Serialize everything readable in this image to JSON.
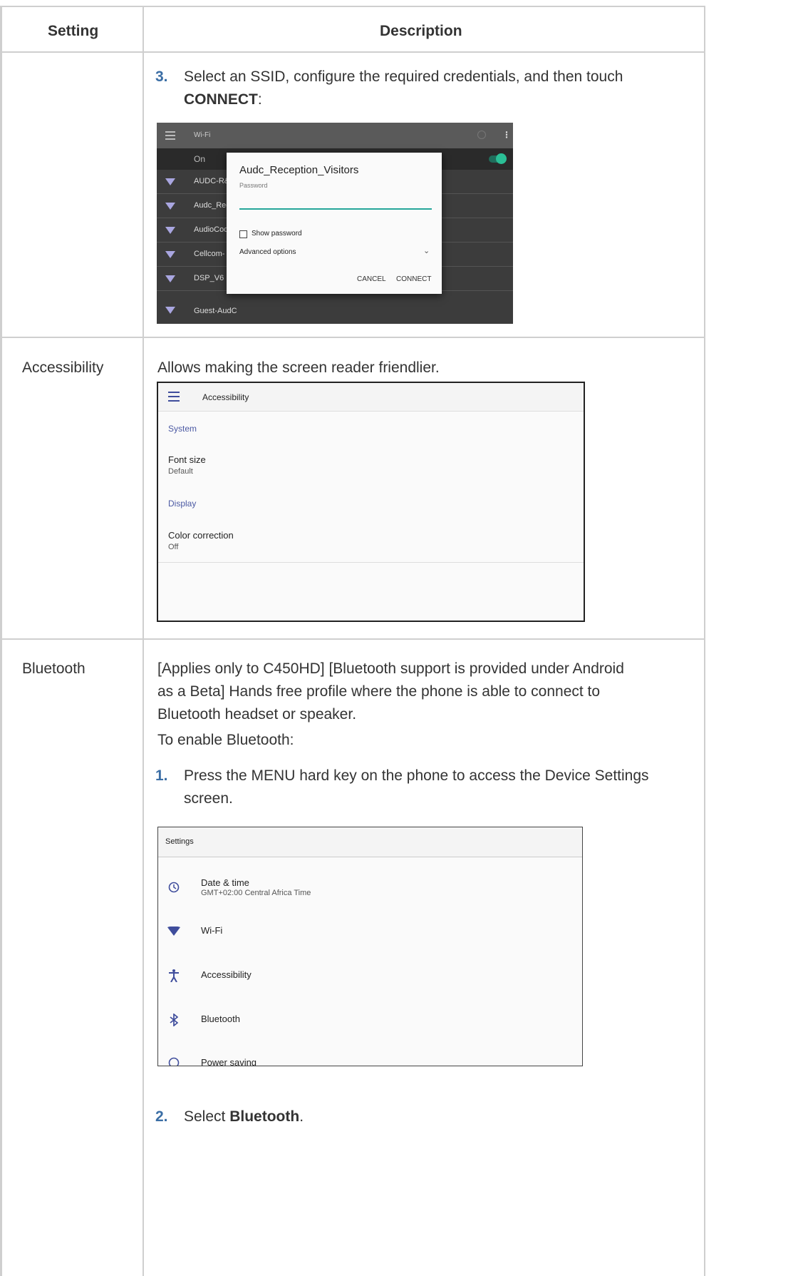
{
  "table": {
    "header_setting": "Setting",
    "header_description": "Description"
  },
  "row_wifi": {
    "step_number": "3.",
    "step_text_start": "Select an SSID, configure the required credentials, and then touch",
    "step_bold": "CONNECT",
    "step_end": ":",
    "screenshot": {
      "title": "Wi-Fi",
      "on_label": "On",
      "networks": [
        "AUDC-R&",
        "Audc_Rec",
        "AudioCod",
        "Cellcom-",
        "DSP_V6",
        "Guest-AudC"
      ],
      "dialog": {
        "ssid": "Audc_Reception_Visitors",
        "password_label": "Password",
        "show_password": "Show password",
        "advanced_options": "Advanced options",
        "cancel": "CANCEL",
        "connect": "CONNECT"
      },
      "colors": {
        "accent": "#26a69a",
        "toggle": "#2bbf96"
      }
    }
  },
  "row_accessibility": {
    "setting": "Accessibility",
    "description": "Allows making the screen reader friendlier.",
    "screenshot": {
      "title": "Accessibility",
      "section_system": "System",
      "font_size": "Font size",
      "font_size_value": "Default",
      "section_display": "Display",
      "color_correction": "Color correction",
      "color_correction_value": "Off"
    }
  },
  "row_bluetooth": {
    "setting": "Bluetooth",
    "desc_line1": "[Applies only to C450HD] [Bluetooth support is provided under Android",
    "desc_line2": "as a Beta] Hands free profile where the phone is able to connect to",
    "desc_line3": "Bluetooth headset or speaker.",
    "to_enable": "To enable Bluetooth:",
    "step1_number": "1.",
    "step1_line1": "Press the MENU hard key on the phone to access the Device Settings",
    "step1_line2": "screen.",
    "screenshot": {
      "title": "Settings",
      "items": [
        {
          "label": "Date & time",
          "sub": "GMT+02:00 Central Africa Time",
          "icon": "clock-icon"
        },
        {
          "label": "Wi-Fi",
          "sub": "",
          "icon": "wifi-icon"
        },
        {
          "label": "Accessibility",
          "sub": "",
          "icon": "accessibility-icon"
        },
        {
          "label": "Bluetooth",
          "sub": "",
          "icon": "bluetooth-icon"
        },
        {
          "label": "Power saving",
          "sub": "",
          "icon": "power-icon"
        }
      ]
    },
    "step2_number": "2.",
    "step2_text": "Select",
    "step2_bold": "Bluetooth",
    "step2_end": "."
  }
}
